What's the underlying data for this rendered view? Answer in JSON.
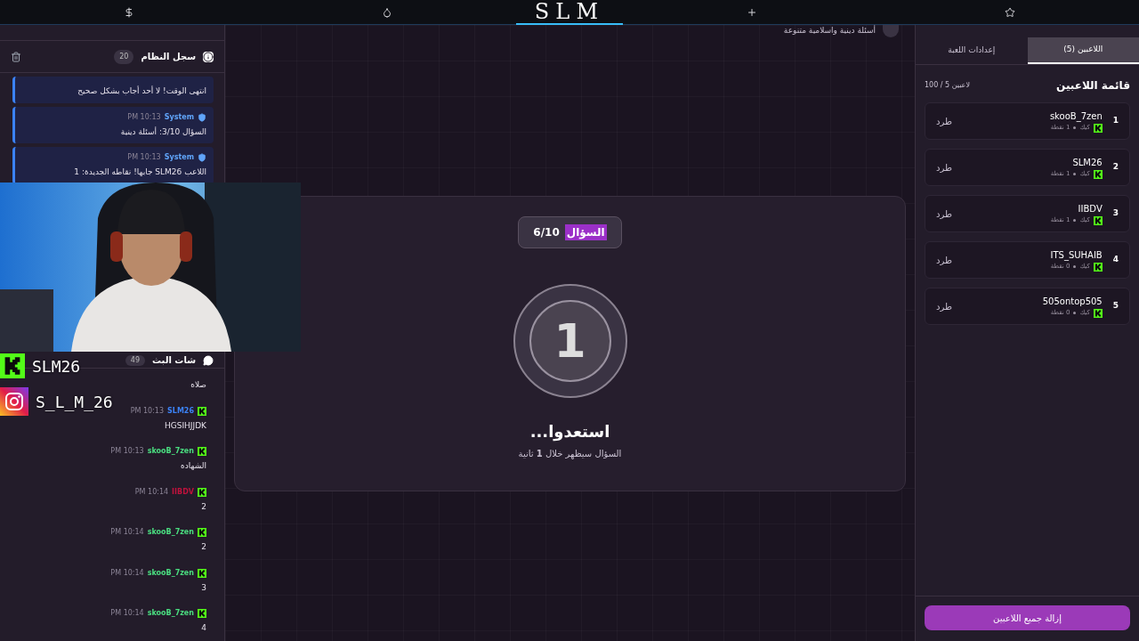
{
  "top_bar": {
    "logo": "SLM"
  },
  "system_log": {
    "title": "سجل النظام",
    "count": "20",
    "messages": [
      {
        "text": "انتهى الوقت! لا أحد أجاب بشكل صحيح"
      },
      {
        "sender": "System",
        "time": "PM 10:13",
        "text": "السؤال 3/10: أسئلة دينية"
      },
      {
        "sender": "System",
        "time": "PM 10:13",
        "text": "اللاعب SLM26 جابها! نقاطه الجديدة: 1"
      }
    ]
  },
  "stream_chat": {
    "title": "شات البث",
    "count": "49",
    "messages": [
      {
        "text": "صلاه"
      },
      {
        "sender": "SLM26",
        "color": "#3b82f6",
        "time": "PM 10:13",
        "text": "HGSIHJJDK"
      },
      {
        "sender": "skooB_7zen",
        "color": "#4ade80",
        "time": "PM 10:13",
        "text": "الشهاده"
      },
      {
        "sender": "IIBDV",
        "color": "#be123c",
        "time": "PM 10:14",
        "text": "2"
      },
      {
        "sender": "skooB_7zen",
        "color": "#4ade80",
        "time": "PM 10:14",
        "text": "2"
      },
      {
        "sender": "skooB_7zen",
        "color": "#4ade80",
        "time": "PM 10:14",
        "text": "3"
      },
      {
        "sender": "skooB_7zen",
        "color": "#4ade80",
        "time": "PM 10:14",
        "text": "4"
      }
    ]
  },
  "overlays": [
    {
      "kind": "kick",
      "handle": "SLM26"
    },
    {
      "kind": "instagram",
      "handle": "S_L_M_26"
    }
  ],
  "quiz": {
    "category": "أسئلة دينية واسلامية متنوعة",
    "question_label": "السؤال",
    "label_highlighted": true,
    "question_progress": "6/10",
    "countdown": "1",
    "title": "استعدوا...",
    "subtitle": "السؤال سيظهر خلال **1** ثانية"
  },
  "side_panel": {
    "tabs": [
      {
        "label": "اللاعبين (5)",
        "selected": true
      },
      {
        "label": "إعدادات اللعبة",
        "selected": false
      }
    ],
    "title": "قائمة اللاعبين",
    "capacity": "100 / 5 لاعبين",
    "players": [
      {
        "rank": "1",
        "name": "skooB_7zen",
        "platform": "كيك",
        "points": "1 نقطة",
        "action": "طرد"
      },
      {
        "rank": "2",
        "name": "SLM26",
        "platform": "كيك",
        "points": "1 نقطة",
        "action": "طرد"
      },
      {
        "rank": "3",
        "name": "IIBDV",
        "platform": "كيك",
        "points": "1 نقطة",
        "action": "طرد"
      },
      {
        "rank": "4",
        "name": "ITS_SUHAIB",
        "platform": "كيك",
        "points": "0 نقطة",
        "action": "طرد"
      },
      {
        "rank": "5",
        "name": "505ontop505",
        "platform": "كيك",
        "points": "0 نقطة",
        "action": "طرد"
      }
    ],
    "remove_all": "إزالة جميع اللاعبين"
  }
}
